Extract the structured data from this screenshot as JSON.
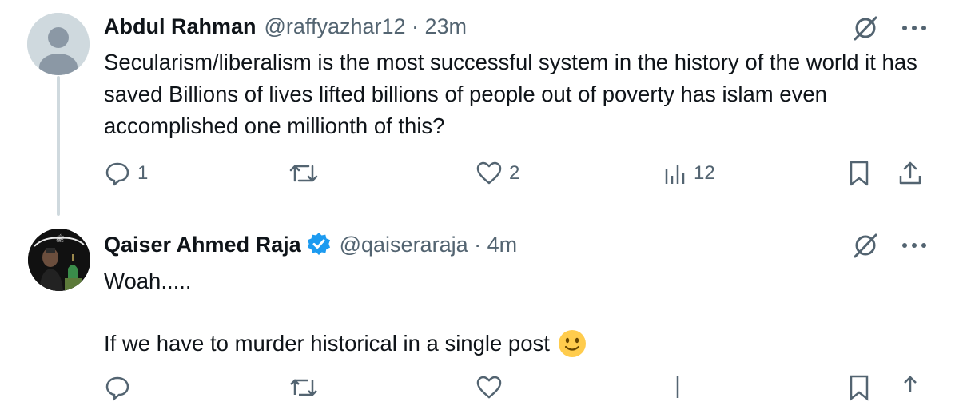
{
  "tweet1": {
    "author": "Abdul Rahman",
    "meta": "@raffyazhar12 · 23m",
    "text": "Secularism/liberalism is the most successful system in the history of the world it has saved Billions of lives lifted billions of people out of poverty has islam even accomplished one millionth of this?",
    "replies": "1",
    "likes": "2",
    "views": "12"
  },
  "tweet2": {
    "author": "Qaiser Ahmed Raja",
    "meta": "@qaiseraraja · 4m",
    "line1": "Woah.....",
    "line2": "If we have to murder historical in a single post",
    "verified": true,
    "avatar_caption": "ﷺ"
  },
  "icons": {
    "grok": "grok-icon",
    "more": "more-icon",
    "reply": "reply-icon",
    "retweet": "retweet-icon",
    "like": "like-icon",
    "views": "views-icon",
    "bookmark": "bookmark-icon",
    "share": "share-icon"
  },
  "colors": {
    "accent": "#1d9bf0",
    "muted": "#536471",
    "text": "#0f1419"
  }
}
